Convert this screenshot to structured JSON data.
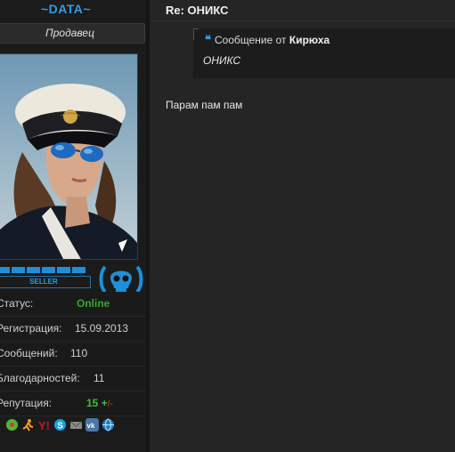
{
  "user": {
    "username": "~DATA~",
    "title": "Продавец",
    "rank_label": "SELLER",
    "rank_segments": 6,
    "info": {
      "status_label": "Статус:",
      "status_value": "Online",
      "registration_label": "Регистрация:",
      "registration_value": "15.09.2013",
      "messages_label": "Сообщений:",
      "messages_value": "110",
      "thanks_label": "Благодарностей:",
      "thanks_value": "11",
      "reputation_label": "Репутация:",
      "reputation_value": "15",
      "reputation_plus": "+",
      "reputation_minus": "/-"
    },
    "contact_icons": [
      "icq-icon",
      "runner-icon",
      "yahoo-icon",
      "skype-icon",
      "mail-icon",
      "vk-icon",
      "globe-icon"
    ]
  },
  "post": {
    "title": "Re: ОНИКС",
    "quote": {
      "prefix": "Сообщение от",
      "author": "Кирюха",
      "text": "ОНИКС"
    },
    "body": "Парам пам пам"
  },
  "colors": {
    "accent": "#2e9de4",
    "online": "#36a82e",
    "background": "#252525",
    "sidebar": "#1b1b1b"
  }
}
